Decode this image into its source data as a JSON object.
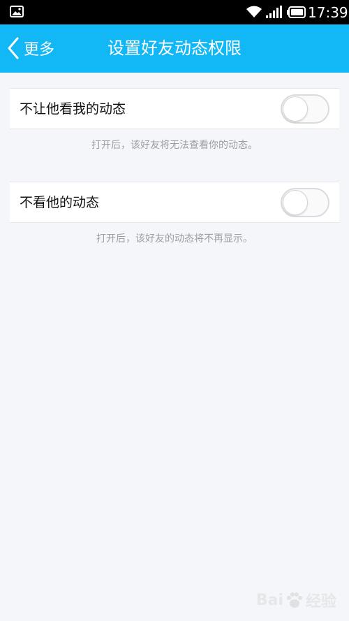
{
  "status_bar": {
    "time": "17:39",
    "icons": [
      "gallery-icon",
      "wifi-icon",
      "signal-icon",
      "battery-icon"
    ]
  },
  "title_bar": {
    "back_label": "更多",
    "title": "设置好友动态权限",
    "background": "#12b7f5"
  },
  "settings": [
    {
      "label": "不让他看我的动态",
      "enabled": false,
      "hint": "打开后，该好友将无法查看你的动态。"
    },
    {
      "label": "不看他的动态",
      "enabled": false,
      "hint": "打开后，该好友的动态将不再显示。"
    }
  ],
  "watermark": {
    "text_left": "Bai",
    "text_right": "经验"
  }
}
